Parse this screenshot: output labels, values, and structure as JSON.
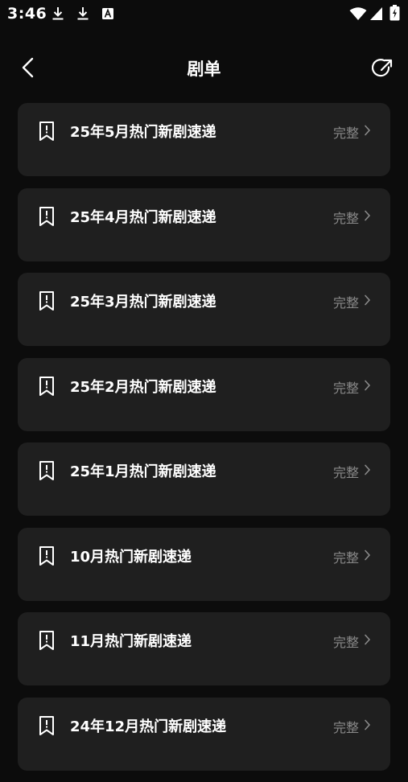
{
  "status_bar": {
    "time": "3:46",
    "icons": [
      "download-icon",
      "download-icon",
      "a-icon",
      "wifi-icon",
      "signal-icon",
      "battery-icon"
    ]
  },
  "header": {
    "back_icon": "chevron-left-icon",
    "title": "剧单",
    "share_icon": "share-icon"
  },
  "playlists": [
    {
      "title": "25年5月热门新剧速递",
      "status": "完整"
    },
    {
      "title": "25年4月热门新剧速递",
      "status": "完整"
    },
    {
      "title": "25年3月热门新剧速递",
      "status": "完整"
    },
    {
      "title": "25年2月热门新剧速递",
      "status": "完整"
    },
    {
      "title": "25年1月热门新剧速递",
      "status": "完整"
    },
    {
      "title": "10月热门新剧速递",
      "status": "完整"
    },
    {
      "title": "11月热门新剧速递",
      "status": "完整"
    },
    {
      "title": "24年12月热门新剧速递",
      "status": "完整"
    }
  ],
  "colors": {
    "background": "#0c0c0c",
    "card": "#1f1f1f",
    "title_text": "#ffffff",
    "status_text": "#8a8a8a"
  }
}
